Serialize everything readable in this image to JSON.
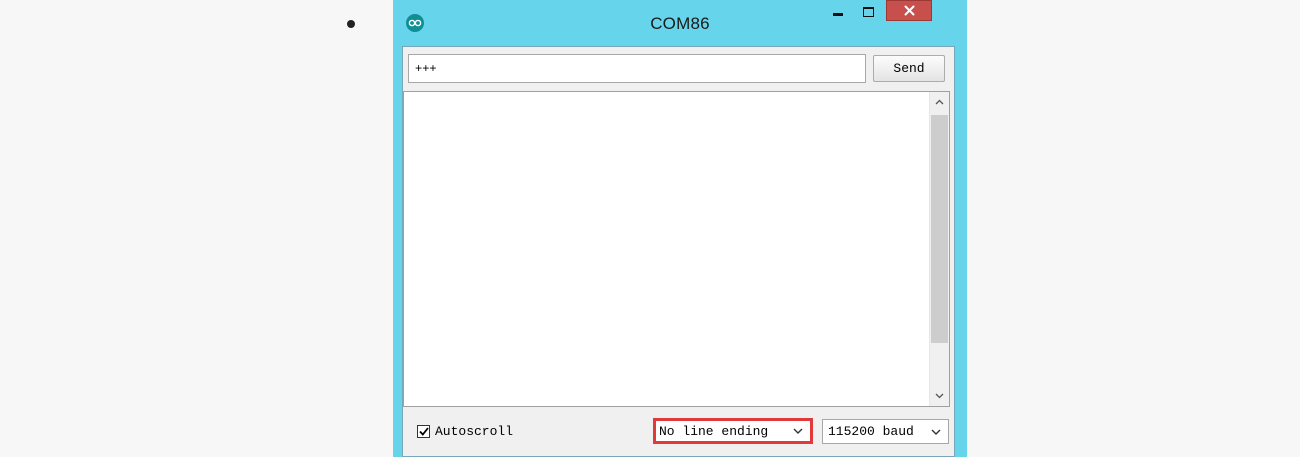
{
  "window": {
    "title": "COM86",
    "colors": {
      "frame": "#66d5ec",
      "close_button": "#c7504c",
      "highlight_box": "#e23a3a"
    },
    "icons": {
      "app": "arduino-logo-icon",
      "minimize": "minimize-icon",
      "maximize": "maximize-icon",
      "close": "close-icon"
    }
  },
  "toolbar": {
    "input_value": "+++",
    "send_label": "Send"
  },
  "output": {
    "text": "",
    "scroll_position": 0
  },
  "bottom": {
    "autoscroll_label": "Autoscroll",
    "autoscroll_checked": true,
    "line_ending": "No line ending",
    "baud": "115200 baud"
  }
}
